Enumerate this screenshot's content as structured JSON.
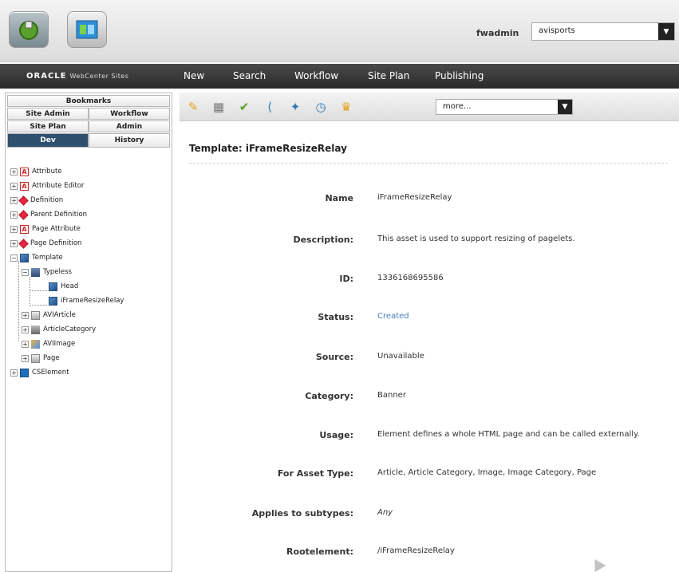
{
  "header": {
    "username": "fwadmin",
    "site": "avisports"
  },
  "navbar": {
    "brand": "ORACLE",
    "product": "WebCenter Sites",
    "items": [
      "New",
      "Search",
      "Workflow",
      "Site Plan",
      "Publishing"
    ]
  },
  "left_tabs": {
    "bookmarks": "Bookmarks",
    "site_admin": "Site Admin",
    "workflow": "Workflow",
    "site_plan": "Site Plan",
    "admin": "Admin",
    "dev": "Dev",
    "history": "History"
  },
  "tree": [
    {
      "label": "Attribute"
    },
    {
      "label": "Attribute Editor"
    },
    {
      "label": "Definition"
    },
    {
      "label": "Parent Definition"
    },
    {
      "label": "Page Attribute"
    },
    {
      "label": "Page Definition"
    },
    {
      "label": "Template"
    },
    {
      "label": "Typeless"
    },
    {
      "label": "Head"
    },
    {
      "label": "iFrameResizeRelay"
    },
    {
      "label": "AVIArticle"
    },
    {
      "label": "ArticleCategory"
    },
    {
      "label": "AVIImage"
    },
    {
      "label": "Page"
    },
    {
      "label": "CSElement"
    }
  ],
  "toolbar": {
    "more": "more..."
  },
  "content": {
    "title": "Template: iFrameResizeRelay",
    "fields": [
      {
        "label": "Name",
        "value": "iFrameResizeRelay"
      },
      {
        "label": "Description:",
        "value": "This asset is used to support resizing of pagelets."
      },
      {
        "label": "ID:",
        "value": "1336168695586"
      },
      {
        "label": "Status:",
        "value": "Created"
      },
      {
        "label": "Source:",
        "value": "Unavailable"
      },
      {
        "label": "Category:",
        "value": "Banner"
      },
      {
        "label": "Usage:",
        "value": "Element defines a whole HTML page and can be called externally."
      },
      {
        "label": "For Asset Type:",
        "value": "Article, Article Category, Image, Image Category, Page"
      },
      {
        "label": "Applies to subtypes:",
        "value": "Any"
      },
      {
        "label": "Rootelement:",
        "value": "/iFrameResizeRelay"
      }
    ]
  },
  "colors": {
    "active_tab": "#2e4f6e",
    "navbar": "#2a2a2a",
    "status_link": "#4a7dbd"
  }
}
